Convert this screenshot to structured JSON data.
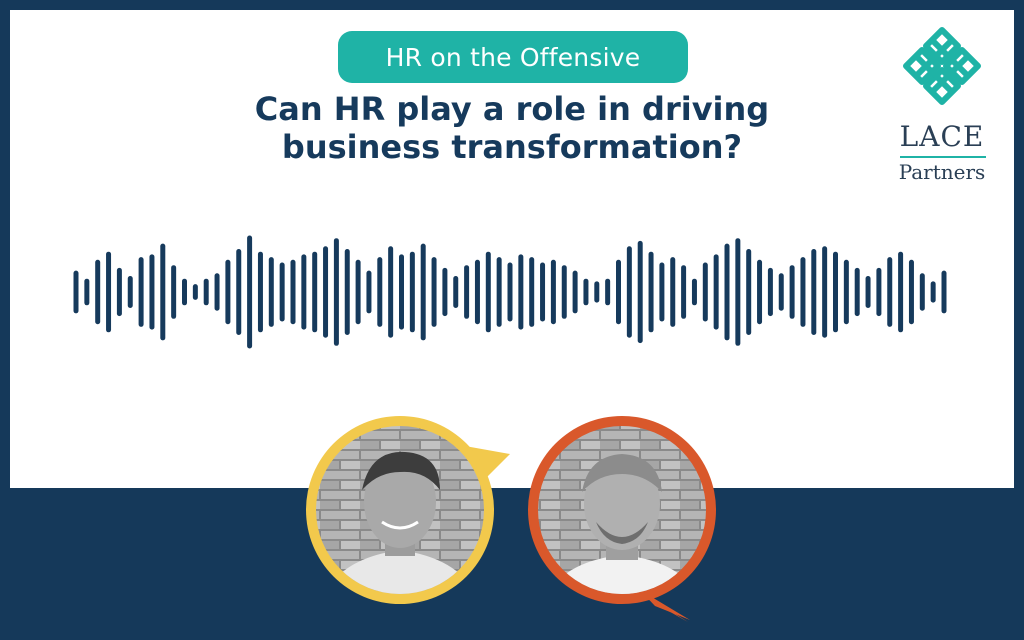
{
  "banner": {
    "series_tag": "HR on the Offensive",
    "headline_line1": "Can HR play a role in driving",
    "headline_line2": "business transformation?"
  },
  "logo": {
    "name": "LACE",
    "subtitle": "Partners"
  },
  "colors": {
    "navy": "#15395a",
    "teal": "#1fb3a6",
    "yellow": "#f2c94c",
    "orange": "#d9582b",
    "wave": "#163a5c"
  },
  "waveform": {
    "levels": [
      0.35,
      0.2,
      0.55,
      0.7,
      0.4,
      0.25,
      0.6,
      0.65,
      0.85,
      0.45,
      0.2,
      0.1,
      0.2,
      0.3,
      0.55,
      0.75,
      1.0,
      0.7,
      0.6,
      0.5,
      0.55,
      0.65,
      0.7,
      0.8,
      0.95,
      0.75,
      0.55,
      0.35,
      0.6,
      0.8,
      0.65,
      0.7,
      0.85,
      0.6,
      0.4,
      0.25,
      0.45,
      0.55,
      0.7,
      0.6,
      0.5,
      0.65,
      0.6,
      0.5,
      0.55,
      0.45,
      0.35,
      0.2,
      0.15,
      0.2,
      0.55,
      0.8,
      0.9,
      0.7,
      0.5,
      0.6,
      0.45,
      0.2,
      0.5,
      0.65,
      0.85,
      0.95,
      0.75,
      0.55,
      0.4,
      0.3,
      0.45,
      0.6,
      0.75,
      0.8,
      0.7,
      0.55,
      0.4,
      0.25,
      0.4,
      0.6,
      0.7,
      0.55,
      0.3,
      0.15,
      0.35
    ]
  },
  "speakers": [
    {
      "name": "speaker-1",
      "ring": "yellow"
    },
    {
      "name": "speaker-2",
      "ring": "orange"
    }
  ]
}
